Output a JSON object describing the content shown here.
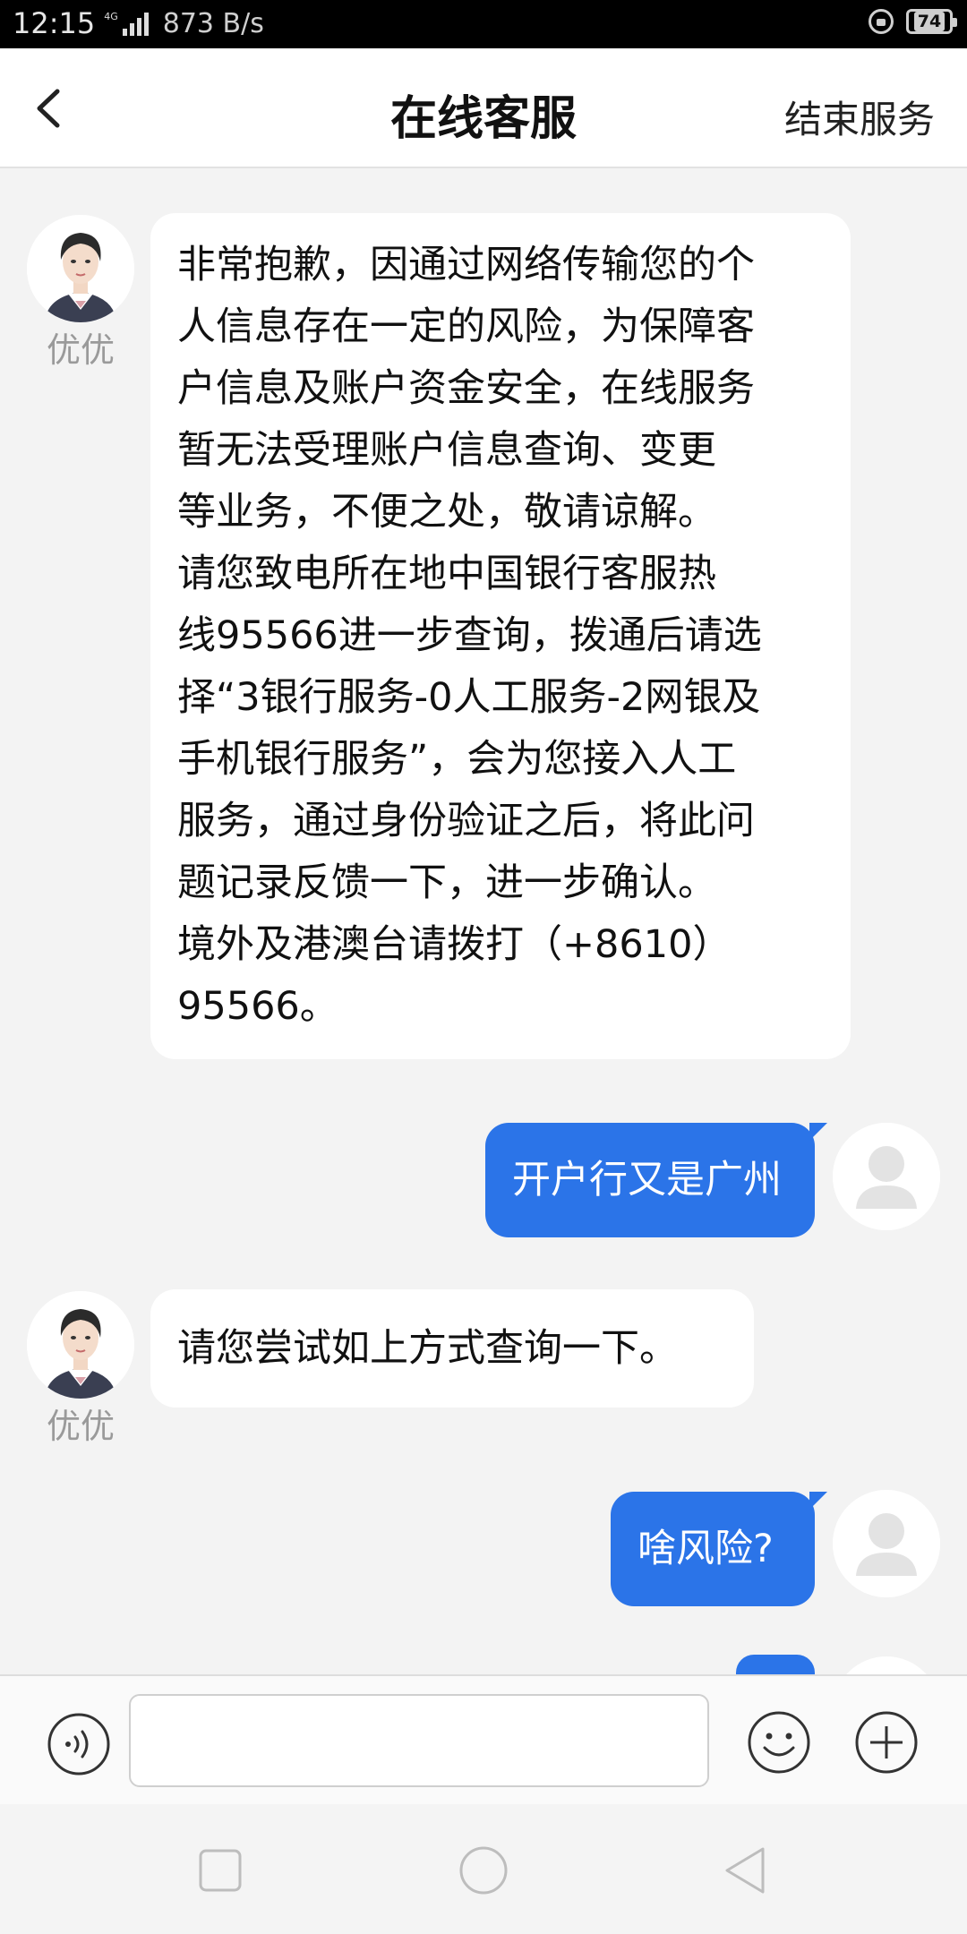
{
  "status_bar": {
    "time": "12:15",
    "network": "4G",
    "speed": "873 B/s",
    "battery": "74"
  },
  "header": {
    "title": "在线客服",
    "end_label": "结束服务"
  },
  "messages": {
    "agent_name": "优优",
    "m1": {
      "sender": "agent",
      "lines": [
        "非常抱歉，因通过网络传输您的个",
        "人信息存在一定的风险，为保障客",
        "户信息及账户资金安全，在线服务",
        "暂无法受理账户信息查询、变更",
        "等业务，不便之处，敬请谅解。",
        "请您致电所在地中国银行客服热",
        "线95566进一步查询，拨通后请选",
        "择“3银行服务-0人工服务-2网银及",
        "手机银行服务”，会为您接入人工",
        "服务，通过身份验证之后，将此问",
        "题记录反馈一下，进一步确认。",
        "境外及港澳台请拨打（+8610）",
        "95566。"
      ]
    },
    "m2": {
      "sender": "user",
      "text": "开户行又是广州"
    },
    "m3": {
      "sender": "agent",
      "text": "请您尝试如上方式查询一下。"
    },
    "m4": {
      "sender": "user",
      "text": "啥风险?"
    }
  },
  "input": {
    "value": "",
    "placeholder": ""
  },
  "colors": {
    "user_bubble": "#2b74e8",
    "background": "#f3f3f3"
  }
}
